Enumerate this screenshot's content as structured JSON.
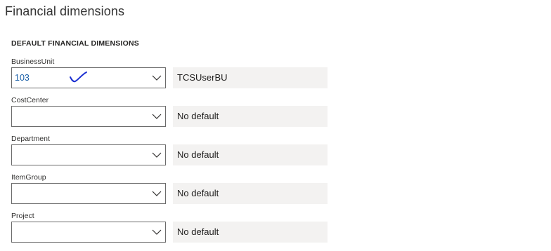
{
  "page": {
    "title": "Financial dimensions"
  },
  "section": {
    "header": "DEFAULT FINANCIAL DIMENSIONS"
  },
  "fields": [
    {
      "label": "BusinessUnit",
      "value": "103",
      "default": "TCSUserBU"
    },
    {
      "label": "CostCenter",
      "value": "",
      "default": "No default"
    },
    {
      "label": "Department",
      "value": "",
      "default": "No default"
    },
    {
      "label": "ItemGroup",
      "value": "",
      "default": "No default"
    },
    {
      "label": "Project",
      "value": "",
      "default": "No default"
    }
  ],
  "icons": {
    "dropdown": "chevron-down-icon",
    "annotation": "handwritten-checkmark"
  },
  "colors": {
    "value_text": "#1a5fa8",
    "default_box_bg": "#f3f2f1",
    "annotation": "#1b2fd1"
  }
}
